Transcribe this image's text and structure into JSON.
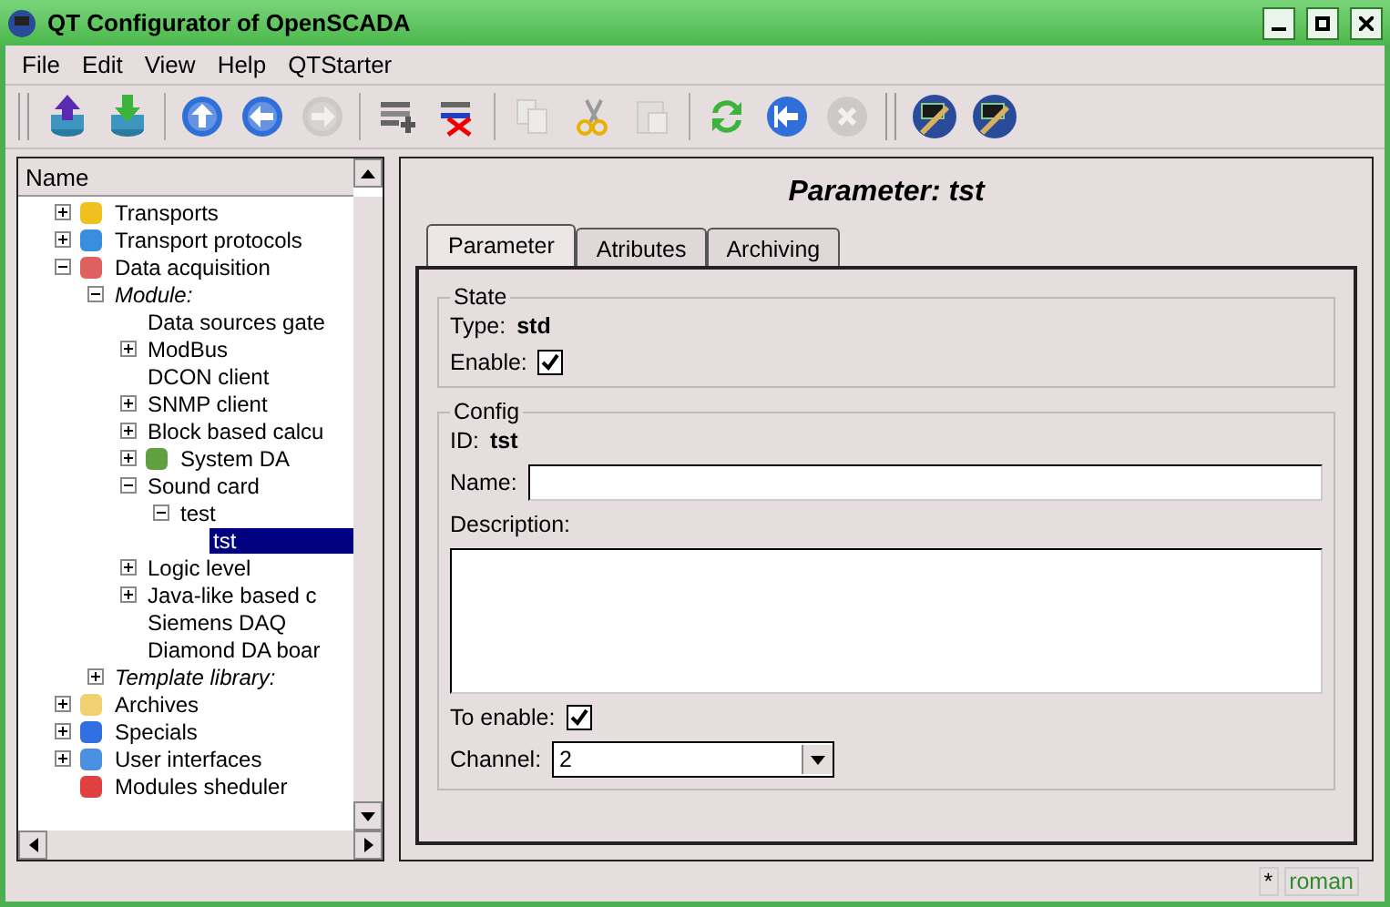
{
  "window": {
    "title": "QT Configurator of OpenSCADA"
  },
  "menu": [
    "File",
    "Edit",
    "View",
    "Help",
    "QTStarter"
  ],
  "toolbar": [
    {
      "kind": "load",
      "disabled": false
    },
    {
      "kind": "save",
      "disabled": false
    },
    {
      "kind": "separator"
    },
    {
      "kind": "up",
      "disabled": false
    },
    {
      "kind": "back",
      "disabled": false
    },
    {
      "kind": "forward",
      "disabled": true
    },
    {
      "kind": "separator"
    },
    {
      "kind": "add",
      "disabled": false
    },
    {
      "kind": "delete",
      "disabled": false
    },
    {
      "kind": "separator"
    },
    {
      "kind": "copy",
      "disabled": true
    },
    {
      "kind": "cut",
      "disabled": false
    },
    {
      "kind": "paste",
      "disabled": true
    },
    {
      "kind": "separator"
    },
    {
      "kind": "refresh",
      "disabled": false
    },
    {
      "kind": "start",
      "disabled": false
    },
    {
      "kind": "stop",
      "disabled": true
    },
    {
      "kind": "handle"
    },
    {
      "kind": "tool",
      "disabled": false
    },
    {
      "kind": "tool",
      "disabled": false
    }
  ],
  "tree": {
    "header": "Name",
    "items": [
      {
        "label": "Transports",
        "expanded": false,
        "selected": false
      },
      {
        "label": "Transport protocols",
        "expanded": false,
        "selected": false
      },
      {
        "label": "Data acquisition",
        "expanded": true,
        "selected": false,
        "children": [
          {
            "label": "Module:",
            "kind": "group",
            "expanded": true,
            "selected": false,
            "children": [
              {
                "label": "Data sources gate",
                "selected": false
              },
              {
                "label": "ModBus",
                "expanded": false,
                "selected": false
              },
              {
                "label": "DCON client",
                "selected": false
              },
              {
                "label": "SNMP client",
                "expanded": false,
                "selected": false
              },
              {
                "label": "Block based calcu",
                "expanded": false,
                "selected": false
              },
              {
                "label": "System DA",
                "expanded": false,
                "selected": false
              },
              {
                "label": "Sound card",
                "expanded": true,
                "selected": false,
                "children": [
                  {
                    "label": "test",
                    "expanded": true,
                    "selected": false,
                    "children": [
                      {
                        "label": "tst",
                        "selected": true
                      }
                    ]
                  }
                ]
              },
              {
                "label": "Logic level",
                "expanded": false,
                "selected": false
              },
              {
                "label": "Java-like based c",
                "expanded": false,
                "selected": false
              },
              {
                "label": "Siemens DAQ",
                "selected": false
              },
              {
                "label": "Diamond DA boar",
                "selected": false
              }
            ]
          },
          {
            "label": "Template library:",
            "kind": "group",
            "expanded": false,
            "selected": false
          }
        ]
      },
      {
        "label": "Archives",
        "expanded": false,
        "selected": false
      },
      {
        "label": "Specials",
        "expanded": false,
        "selected": false
      },
      {
        "label": "User interfaces",
        "expanded": false,
        "selected": false
      },
      {
        "label": "Modules sheduler",
        "selected": false
      }
    ]
  },
  "panel": {
    "title": "Parameter: tst",
    "tabs": [
      {
        "label": "Parameter",
        "selected": true
      },
      {
        "label": "Atributes",
        "selected": false
      },
      {
        "label": "Archiving",
        "selected": false
      }
    ],
    "state": {
      "legend": "State",
      "type_label": "Type:",
      "type_value": "std",
      "enable_label": "Enable:",
      "enable_checked": true
    },
    "config": {
      "legend": "Config",
      "id_label": "ID:",
      "id_value": "tst",
      "name_label": "Name:",
      "description_label": "Description:",
      "to_enable_label": "To enable:",
      "to_enable_checked": true,
      "channel_label": "Channel:",
      "channel_value": "2"
    }
  },
  "status_bar": {
    "modified": "*",
    "user": "roman"
  }
}
